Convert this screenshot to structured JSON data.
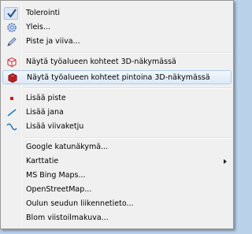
{
  "menu": {
    "items": [
      {
        "label": "Tolerointi",
        "icon": "checkmark-icon",
        "checked": true
      },
      {
        "label": "Yleis...",
        "icon": "settings-gear-icon"
      },
      {
        "label": "Piste ja viiva...",
        "icon": "pencil-icon"
      },
      {
        "label": "Näytä työalueen kohteet 3D-näkymässä",
        "icon": "3d-box-outline-icon"
      },
      {
        "label": "Näytä työalueen kohteet pintoina 3D-näkymässä",
        "icon": "3d-box-solid-icon"
      },
      {
        "label": "Lisää piste",
        "icon": "point-icon"
      },
      {
        "label": "Lisää jana",
        "icon": "line-segment-icon"
      },
      {
        "label": "Lisää viivaketju",
        "icon": "polyline-icon"
      },
      {
        "label": "Google katunäkymä..."
      },
      {
        "label": "Karttatie",
        "submenu": true
      },
      {
        "label": "MS Bing Maps..."
      },
      {
        "label": "OpenStreetMap..."
      },
      {
        "label": "Oulun seudun liikennetieto..."
      },
      {
        "label": "Blom viistoilmakuva..."
      }
    ]
  },
  "colors": {
    "checkmark": "#2a4a8a",
    "gear": "#4a72b8",
    "pencil": "#6a7aa8",
    "box_red": "#cc2222",
    "point_red": "#d01818",
    "line_blue": "#1e78c8"
  }
}
